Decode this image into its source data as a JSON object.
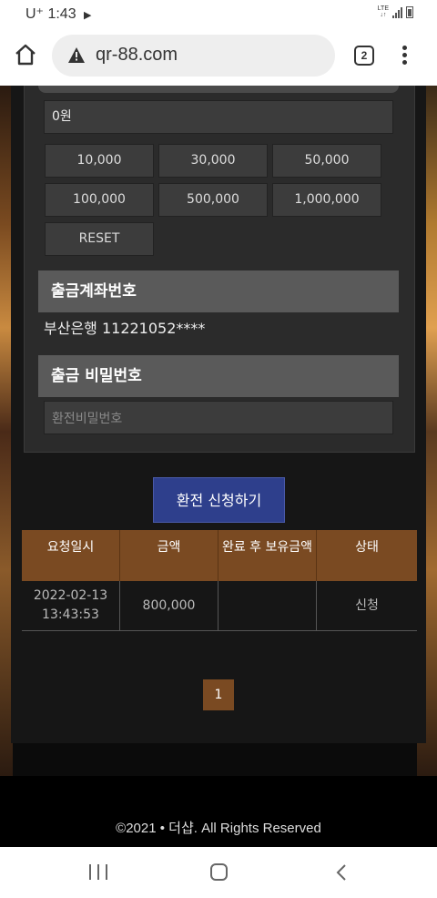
{
  "status_bar": {
    "carrier": "U⁺",
    "time": "1:43",
    "network": "LTE"
  },
  "browser": {
    "url": "qr-88.com",
    "tab_count": "2"
  },
  "amount": {
    "current": "0원",
    "buttons": [
      "10,000",
      "30,000",
      "50,000",
      "100,000",
      "500,000",
      "1,000,000"
    ],
    "reset_label": "RESET"
  },
  "account": {
    "header": "출금계좌번호",
    "value": "부산은행 11221052****"
  },
  "password": {
    "header": "출금 비밀번호",
    "placeholder": "환전비밀번호"
  },
  "submit_label": "환전 신청하기",
  "history": {
    "columns": [
      "요청일시",
      "금액",
      "완료 후 보유금액",
      "상태"
    ],
    "rows": [
      {
        "datetime": "2022-02-13 13:43:53",
        "amount": "800,000",
        "balance": "",
        "status": "신청"
      }
    ]
  },
  "pagination": {
    "current": "1"
  },
  "footer": {
    "copyright": "©2021 • 더샵. All Rights Reserved"
  },
  "colors": {
    "accent_brown": "#7a4a22",
    "submit_blue": "#2e3f8c"
  }
}
